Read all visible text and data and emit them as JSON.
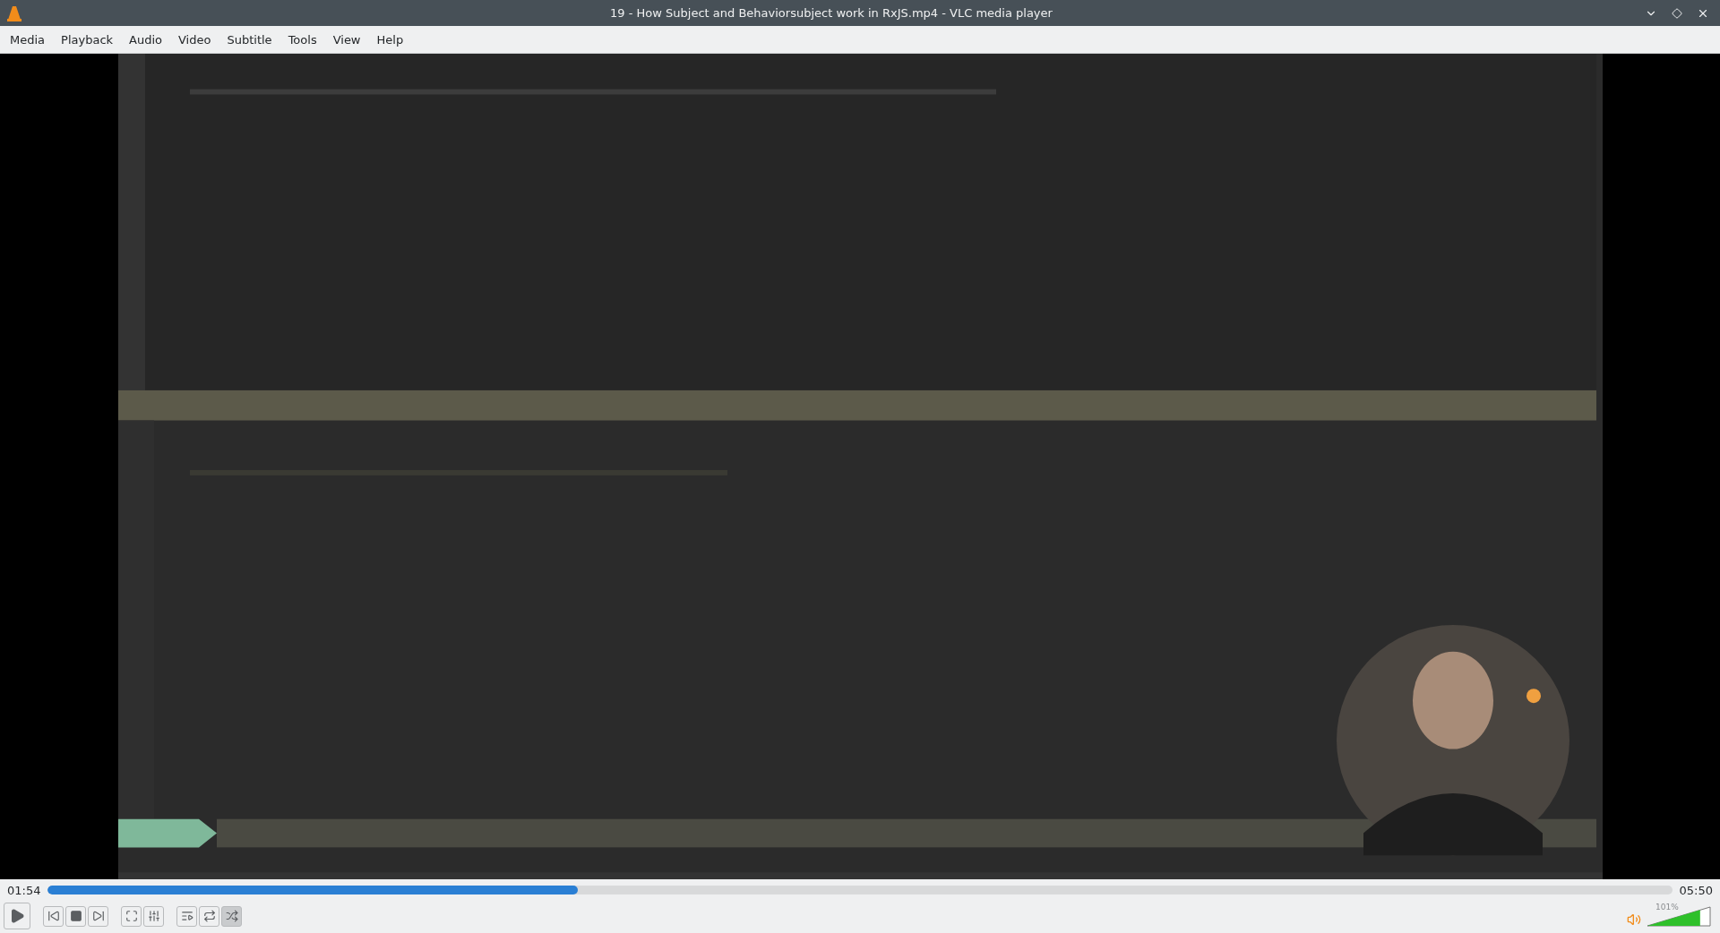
{
  "window": {
    "title": "19 - How Subject and Behaviorsubject work in RxJS.mp4 - VLC media player"
  },
  "menu": [
    "Media",
    "Playback",
    "Audio",
    "Video",
    "Subtitle",
    "Tools",
    "View",
    "Help"
  ],
  "video": {
    "kind": "picture"
  },
  "seek": {
    "elapsed": "01:54",
    "total": "05:50",
    "level": 0.326
  },
  "controls": [
    {
      "kind": "play",
      "pressed": false
    },
    {
      "kind": "prev",
      "pressed": false
    },
    {
      "kind": "stop",
      "pressed": false
    },
    {
      "kind": "next",
      "pressed": false
    },
    {
      "kind": "fullscreen",
      "pressed": false
    },
    {
      "kind": "settings",
      "pressed": false
    },
    {
      "kind": "playlist",
      "pressed": false
    },
    {
      "kind": "loop",
      "pressed": false
    },
    {
      "kind": "shuffle",
      "pressed": true
    }
  ],
  "volume": {
    "reading": "101%",
    "level": 0.84
  }
}
